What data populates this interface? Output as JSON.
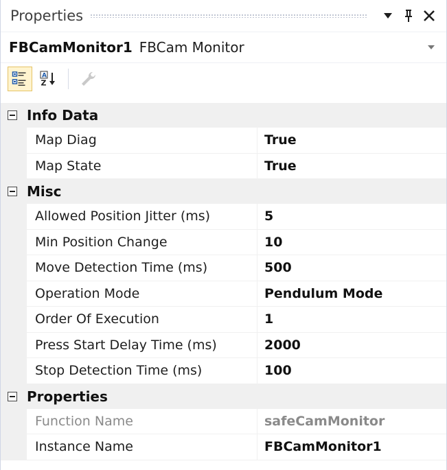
{
  "window": {
    "title": "Properties",
    "pin_icon": "pin-icon",
    "close_icon": "close-icon",
    "dropdown_icon": "dropdown-arrow-icon"
  },
  "selector": {
    "object_name": "FBCamMonitor1",
    "object_type": "FBCam Monitor"
  },
  "toolbar": {
    "buttons": [
      {
        "icon": "categorized-icon",
        "active": true
      },
      {
        "icon": "alphabetical-sort-icon",
        "active": false
      },
      {
        "icon": "property-pages-wrench-icon",
        "active": false,
        "disabled": true
      }
    ]
  },
  "categories": [
    {
      "label": "Info Data",
      "rows": [
        {
          "name": "Map Diag",
          "value": "True"
        },
        {
          "name": "Map State",
          "value": "True"
        }
      ]
    },
    {
      "label": "Misc",
      "rows": [
        {
          "name": "Allowed Position Jitter (ms)",
          "value": "5"
        },
        {
          "name": "Min Position Change",
          "value": "10"
        },
        {
          "name": "Move Detection Time (ms)",
          "value": "500"
        },
        {
          "name": "Operation Mode",
          "value": "Pendulum Mode"
        },
        {
          "name": "Order Of Execution",
          "value": "1"
        },
        {
          "name": "Press Start Delay Time (ms)",
          "value": "2000"
        },
        {
          "name": "Stop Detection Time (ms)",
          "value": "100"
        }
      ]
    },
    {
      "label": "Properties",
      "rows": [
        {
          "name": "Function Name",
          "value": "safeCamMonitor",
          "readonly": true
        },
        {
          "name": "Instance Name",
          "value": "FBCamMonitor1"
        }
      ]
    }
  ],
  "colors": {
    "category_bg": "#f0f0f0",
    "active_tool_border": "#e5c365",
    "active_tool_bg": "#fff4cf",
    "readonly_text": "#8a8a8a"
  }
}
